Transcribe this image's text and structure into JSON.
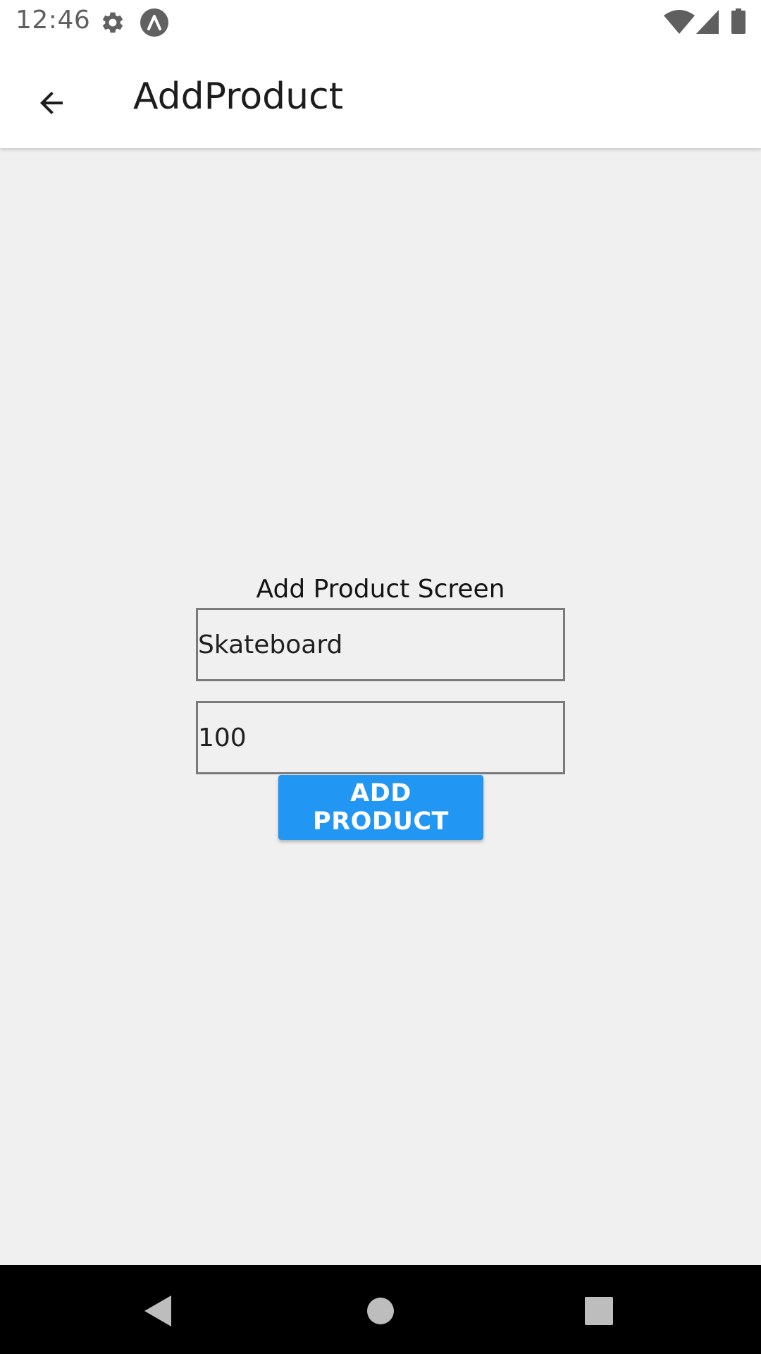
{
  "status_bar": {
    "time": "12:46",
    "icons": [
      "gear-icon",
      "a-icon",
      "wifi-icon",
      "signal-icon",
      "battery-icon"
    ]
  },
  "app_bar": {
    "title": "AddProduct",
    "back_icon": "arrow-back-icon"
  },
  "main": {
    "screen_label": "Add Product Screen",
    "name_field_value": "Skateboard",
    "price_field_value": "100",
    "add_button_label": "ADD PRODUCT"
  },
  "nav_bar": {
    "icons": [
      "back-triangle-icon",
      "home-circle-icon",
      "recents-square-icon"
    ]
  },
  "colors": {
    "accent": "#2196f3",
    "background": "#f0f0f0",
    "app_bar": "#ffffff",
    "nav_bar": "#000000"
  }
}
